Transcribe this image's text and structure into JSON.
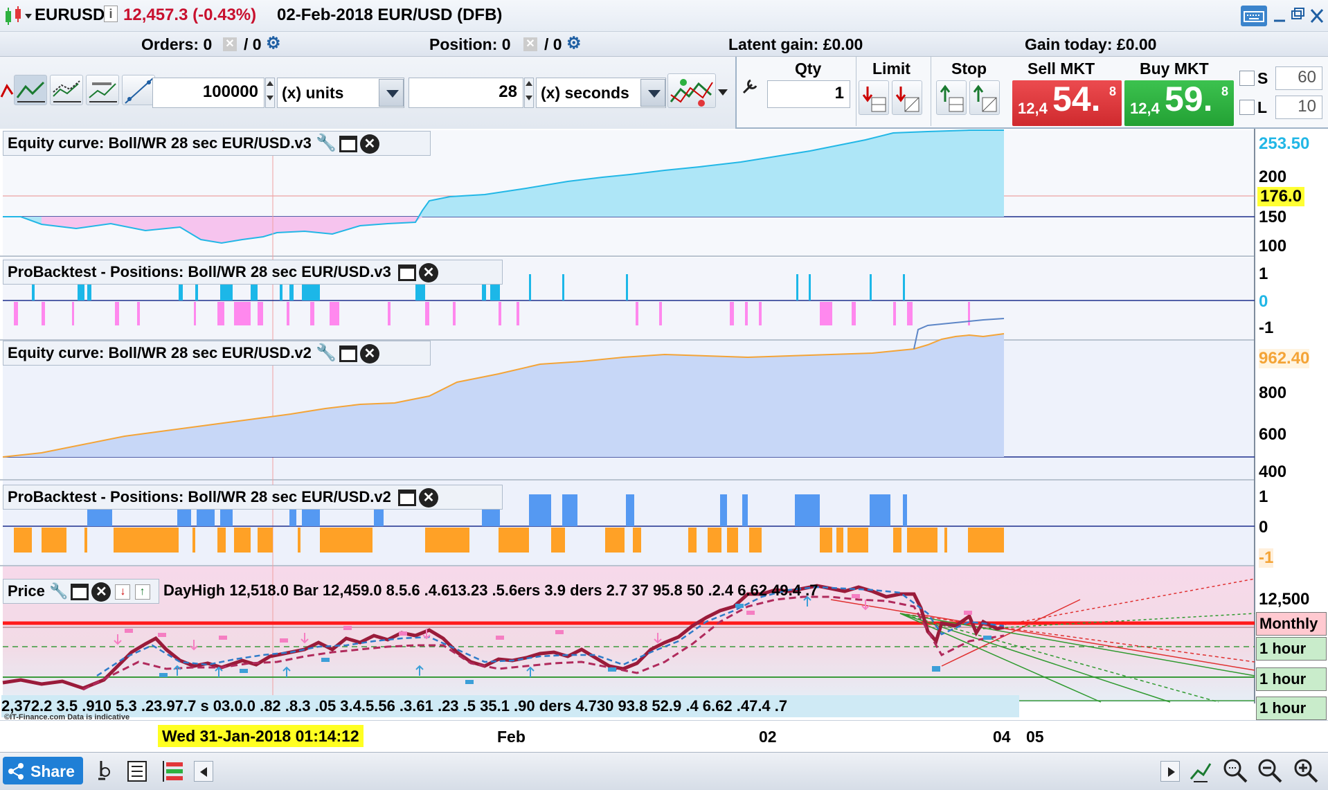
{
  "header": {
    "symbol": "EURUSD",
    "info": "i",
    "price_change": "12,457.3 (-0.43%)",
    "description": "02-Feb-2018 EUR/USD (DFB)"
  },
  "orders_bar": {
    "orders": "Orders: 0",
    "orders_sep": "/ 0",
    "position": "Position: 0",
    "position_sep": "/ 0",
    "latent_gain": "Latent gain: £0.00",
    "gain_today": "Gain today: £0.00"
  },
  "toolbar": {
    "quantity_value": "100000",
    "units_label": "(x) units",
    "period_value": "28",
    "seconds_label": "(x) seconds"
  },
  "trade": {
    "qty_label": "Qty",
    "qty_value": "1",
    "limit_label": "Limit",
    "stop_label": "Stop",
    "sell_label": "Sell MKT",
    "sell_small": "12,4",
    "sell_big": "54.",
    "sell_sup": "8",
    "buy_label": "Buy MKT",
    "buy_small": "12,4",
    "buy_big": "59.",
    "buy_sup": "8",
    "s_label": "S",
    "s_value": "60",
    "l_label": "L",
    "l_value": "10"
  },
  "panes": {
    "equity_v3": {
      "title": "Equity curve: Boll/WR 28 sec EUR/USD.v3",
      "last_value": "253.50",
      "marker_value": "176.0",
      "ticks": [
        "200",
        "150",
        "100"
      ]
    },
    "positions_v3": {
      "title": "ProBacktest - Positions: Boll/WR 28 sec EUR/USD.v3",
      "ticks": [
        "1",
        "0",
        "-1"
      ]
    },
    "equity_v2": {
      "title": "Equity curve: Boll/WR 28 sec EUR/USD.v2",
      "last_value": "962.40",
      "ticks": [
        "800",
        "600",
        "400"
      ]
    },
    "positions_v2": {
      "title": "ProBacktest - Positions: Boll/WR 28 sec EUR/USD.v2",
      "ticks": [
        "1",
        "0",
        "-1"
      ]
    },
    "price": {
      "title": "Price",
      "overlay_top": "DayHigh 12,518.0 Bar 12,459.0 8.5.6 .4.613.23 .5.6ers 3.9 ders 2.7 37 95.8 50 .2.4 6.62 49.4 .7",
      "overlay_bottom": "2,372.2 3.5 .910 5.3 .23.97.7 s 03.0.0 .82 .8.3 .05 3.4.5.56 .3.61 .23 .5 35.1 .90 ders 4.730 93.8 52.9 .4 6.62 .47.4 .7",
      "top_tick": "12,500",
      "tags": [
        "Monthly",
        "1 hour",
        "1 hour",
        "1 hour"
      ],
      "watermark": "©IT-Finance.com  Data is indicative"
    }
  },
  "x_axis": {
    "cursor_label": "Wed 31-Jan-2018 01:14:12",
    "labels": [
      "Feb",
      "02",
      "04",
      "05"
    ]
  },
  "bottom": {
    "share_label": "Share"
  },
  "colors": {
    "v3_fill": "#aee6f7",
    "v3_line": "#22b7e6",
    "v3_neg": "#f6c4ee",
    "v2_fill": "#c7d7f7",
    "v2_line": "#f4a437",
    "pos_pink": "#ff88ee",
    "pos_blue": "#1cb7e8",
    "pos2_blue": "#5599f2",
    "pos2_orange": "#ffa126",
    "sell": "#e2363a",
    "buy": "#2db140"
  }
}
